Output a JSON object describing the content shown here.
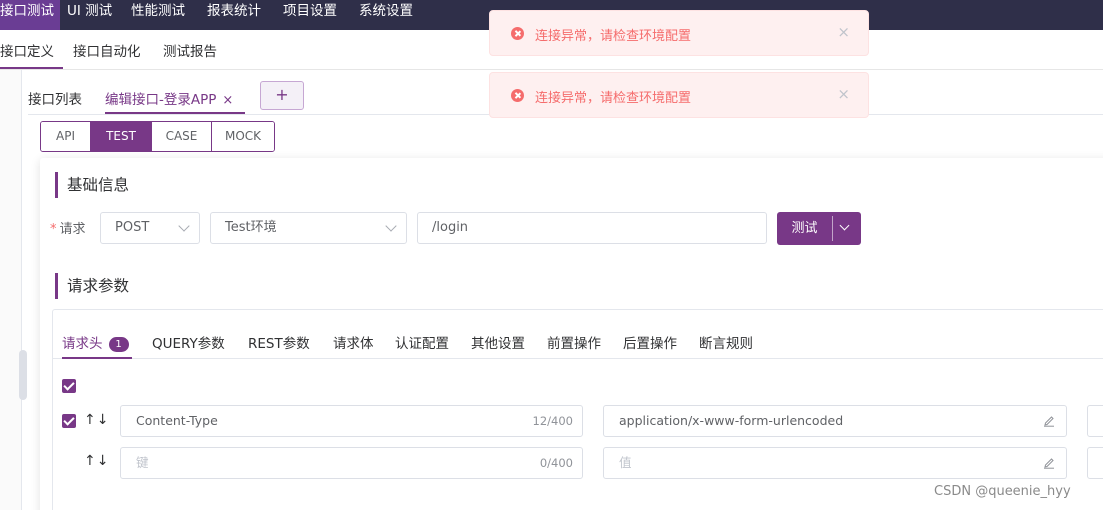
{
  "topnav": {
    "items": [
      "接口测试",
      "UI 测试",
      "性能测试",
      "报表统计",
      "项目设置",
      "系统设置"
    ]
  },
  "subnav": {
    "items": [
      "接口定义",
      "接口自动化",
      "测试报告"
    ]
  },
  "file_tabs": {
    "list_tab": "接口列表",
    "edit_tab": "编辑接口-登录APP",
    "close": "×",
    "add": "+"
  },
  "modes": [
    "API",
    "TEST",
    "CASE",
    "MOCK"
  ],
  "basic": {
    "title": "基础信息",
    "request_label": "请求",
    "required_mark": "*",
    "method": "POST",
    "environment": "Test环境",
    "path": "/login",
    "test_button": "测试"
  },
  "params": {
    "title": "请求参数",
    "tabs": [
      "请求头",
      "QUERY参数",
      "REST参数",
      "请求体",
      "认证配置",
      "其他设置",
      "前置操作",
      "后置操作",
      "断言规则"
    ],
    "header_badge": "1",
    "rows": [
      {
        "key": "Content-Type",
        "key_count": "12/400",
        "value": "application/x-www-form-urlencoded",
        "checked": true
      },
      {
        "key_placeholder": "键",
        "key_count": "0/400",
        "value_placeholder": "值",
        "checked": false
      }
    ]
  },
  "toasts": [
    {
      "message": "连接异常，请检查环境配置",
      "close": "×"
    },
    {
      "message": "连接异常，请检查环境配置",
      "close": "×"
    }
  ],
  "watermark": "CSDN @queenie_hyy",
  "colors": {
    "accent": "#783887",
    "nav_bg": "#2f2f49",
    "error": "#f56c6c",
    "error_bg": "#fef0f0"
  }
}
